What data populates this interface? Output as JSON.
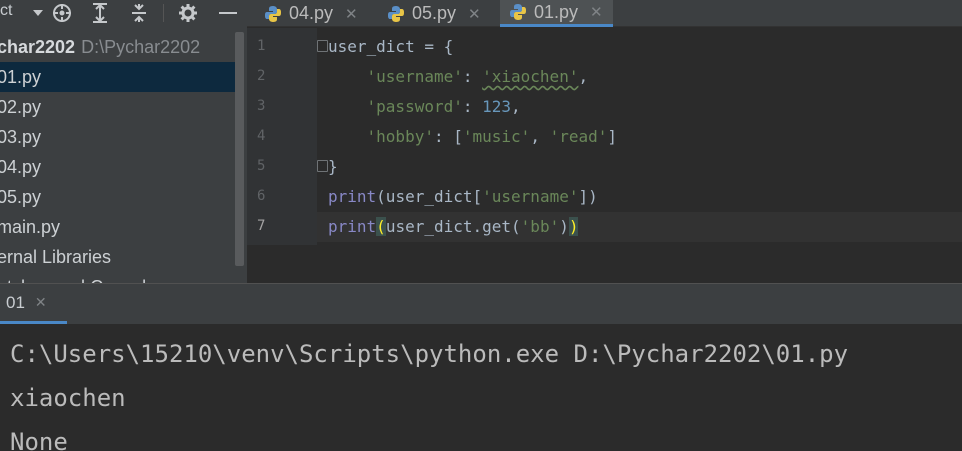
{
  "project_panel": {
    "title": "ct",
    "root_name": "char2202",
    "root_path": "D:\\Pychar2202",
    "files": [
      "01.py",
      "02.py",
      "03.py",
      "04.py",
      "05.py",
      "main.py"
    ],
    "external_libraries": "ernal Libraries",
    "scratches": "atches and Consoles"
  },
  "editor_tabs": [
    {
      "label": "04.py",
      "active": false
    },
    {
      "label": "05.py",
      "active": false
    },
    {
      "label": "01.py",
      "active": true
    }
  ],
  "editor": {
    "line_numbers": [
      "1",
      "2",
      "3",
      "4",
      "5",
      "6",
      "7"
    ],
    "current_line": 7,
    "code": {
      "l1": "user_dict = {",
      "l2_key": "'username'",
      "l2_sep": ": ",
      "l2_val": "'xiaochen'",
      "l2_end": ",",
      "l3_key": "'password'",
      "l3_sep": ": ",
      "l3_val": "123",
      "l3_end": ",",
      "l4_key": "'hobby'",
      "l4_sep": ": [",
      "l4_v1": "'music'",
      "l4_comma": ", ",
      "l4_v2": "'read'",
      "l4_end": "]",
      "l5": "}",
      "l6_fn": "print",
      "l6_a": "(user_dict[",
      "l6_str": "'username'",
      "l6_b": "])",
      "l7_fn": "print",
      "l7_open": "(",
      "l7_a": "user_dict.get(",
      "l7_str": "'bb'",
      "l7_b": ")",
      "l7_close": ")"
    }
  },
  "run_panel": {
    "tab_label": "01",
    "output": [
      "C:\\Users\\15210\\venv\\Scripts\\python.exe D:\\Pychar2202\\01.py",
      "xiaochen",
      "None"
    ]
  },
  "colors": {
    "background": "#2b2b2b",
    "panel": "#3c3f41",
    "selection": "#0d293e",
    "accent": "#4a88c7",
    "string": "#6a8759",
    "number": "#6897bb",
    "builtin": "#8888c6"
  },
  "icons": [
    "caret-down-icon",
    "crosshair-icon",
    "expand-all-icon",
    "collapse-all-icon",
    "gear-icon",
    "minimize-icon",
    "python-file-icon",
    "close-icon"
  ]
}
